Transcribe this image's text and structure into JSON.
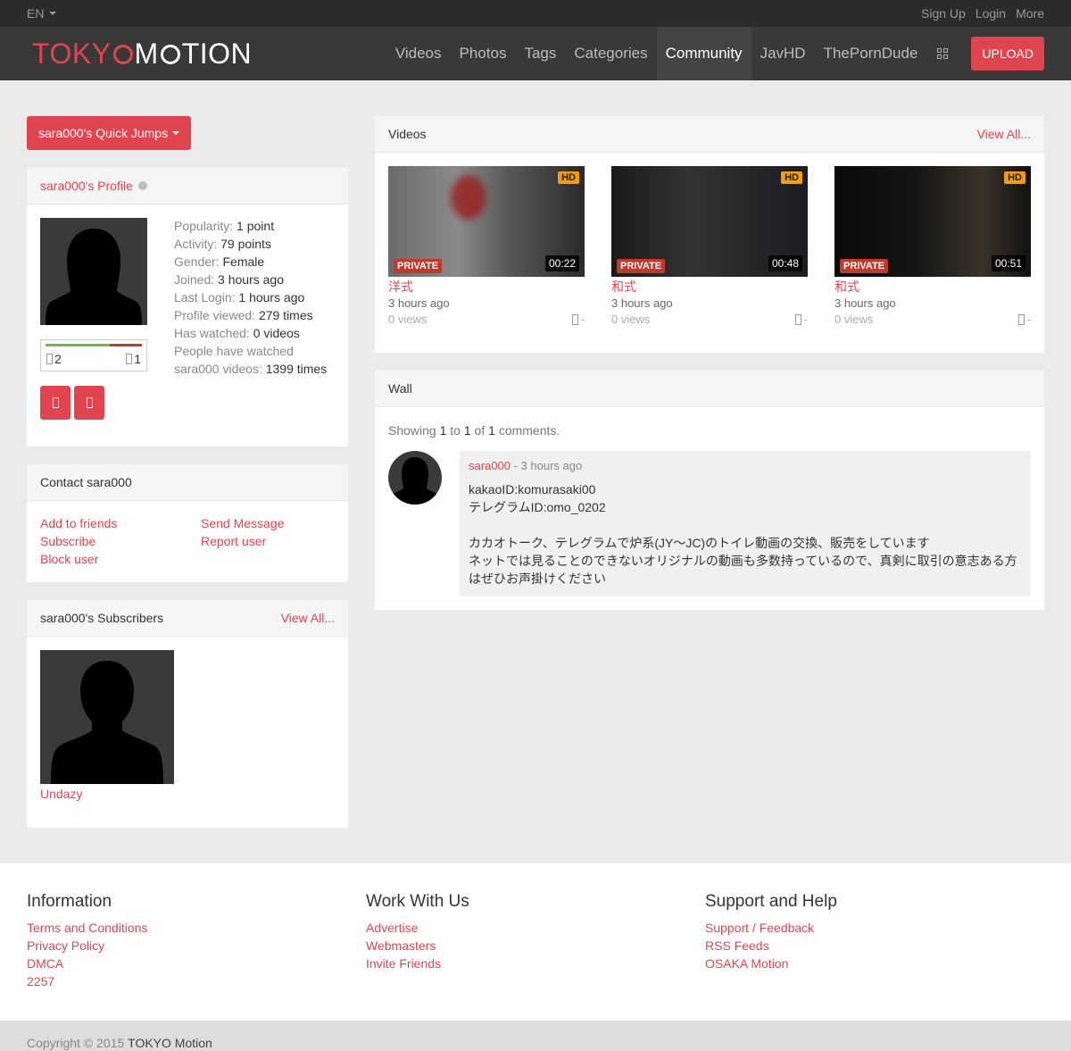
{
  "topbar": {
    "lang": "EN",
    "sign_up": "Sign Up",
    "login": "Login",
    "more": "More"
  },
  "logo": {
    "part1": "TOKY",
    "part2": "M",
    "part3": "TION"
  },
  "nav": {
    "videos": "Videos",
    "photos": "Photos",
    "tags": "Tags",
    "categories": "Categories",
    "community": "Community",
    "javhd": "JavHD",
    "theporndude": "ThePornDude",
    "upload": "UPLOAD"
  },
  "quick_jumps": "sara000's Quick Jumps",
  "profile": {
    "title": "sara000's Profile",
    "stats": [
      {
        "label": "Popularity:",
        "value": "1 point"
      },
      {
        "label": "Activity:",
        "value": "79 points"
      },
      {
        "label": "Gender:",
        "value": "Female"
      },
      {
        "label": "Joined:",
        "value": "3 hours ago"
      },
      {
        "label": "Last Login:",
        "value": "1 hours ago"
      },
      {
        "label": "Profile viewed:",
        "value": "279 times"
      },
      {
        "label": "Has watched:",
        "value": "0 videos"
      },
      {
        "label": "People have watched",
        "value": ""
      },
      {
        "label": "sara000 videos:",
        "value": "1399 times"
      }
    ],
    "likes": "2",
    "dislikes": "1",
    "like_ratio": 0.67
  },
  "contact": {
    "title": "Contact sara000",
    "add_friends": "Add to friends",
    "send_message": "Send Message",
    "subscribe": "Subscribe",
    "report": "Report user",
    "block": "Block user"
  },
  "subscribers": {
    "title": "sara000's Subscribers",
    "view_all": "View All...",
    "items": [
      {
        "name": "Undazy"
      }
    ]
  },
  "videos": {
    "title": "Videos",
    "view_all": "View All...",
    "items": [
      {
        "title": "洋式",
        "time": "3 hours ago",
        "views": "0 views",
        "duration": "00:22",
        "hd": "HD",
        "private": "PRIVATE",
        "rating": "-"
      },
      {
        "title": "和式",
        "time": "3 hours ago",
        "views": "0 views",
        "duration": "00:48",
        "hd": "HD",
        "private": "PRIVATE",
        "rating": "-"
      },
      {
        "title": "和式",
        "time": "3 hours ago",
        "views": "0 views",
        "duration": "00:51",
        "hd": "HD",
        "private": "PRIVATE",
        "rating": "-"
      }
    ]
  },
  "wall": {
    "title": "Wall",
    "showing_prefix": "Showing",
    "from": "1",
    "to_word": "to",
    "to": "1",
    "of_word": "of",
    "total": "1",
    "suffix": "comments.",
    "comment": {
      "author": "sara000",
      "time": "- 3 hours ago",
      "text": "kakaoID:komurasaki00\nテレグラムID:omo_0202\n\nカカオトーク、テレグラムで炉系(JY〜JC)のトイレ動画の交換、販売をしています\nネットでは見ることのできないオリジナルの動画も多数持っているので、真剣に取引の意志ある方はぜひお声掛けください"
    }
  },
  "footer": {
    "information": {
      "title": "Information",
      "links": [
        "Terms and Conditions",
        "Privacy Policy",
        "DMCA",
        "2257"
      ]
    },
    "work": {
      "title": "Work With Us",
      "links": [
        "Advertise",
        "Webmasters",
        "Invite Friends"
      ]
    },
    "support": {
      "title": "Support and Help",
      "links": [
        "Support / Feedback",
        "RSS Feeds",
        "OSAKA Motion"
      ]
    }
  },
  "copyright": {
    "text": "Copyright © 2015",
    "brand": "TOKYO Motion"
  },
  "colors": {
    "accent": "#e0454f",
    "nav_bg": "#393939",
    "topbar_bg": "#2b2b2b",
    "hd_badge": "#f39c12",
    "private_badge": "#c0392b"
  }
}
